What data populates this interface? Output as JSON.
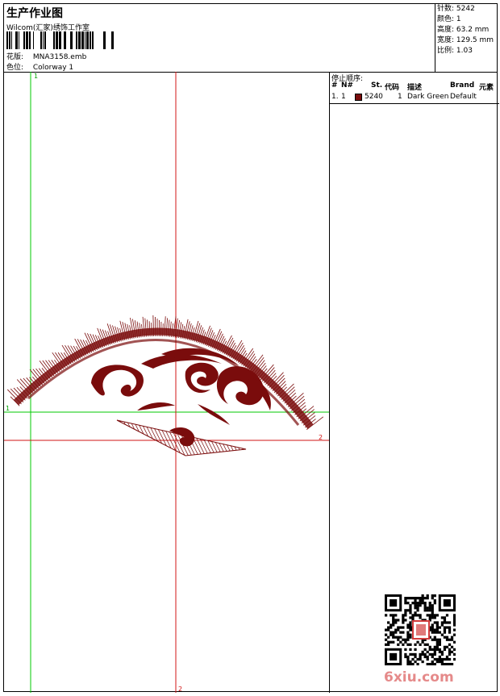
{
  "header": {
    "title": "生产作业图",
    "studio": "Wilcom(汇家)绣饰工作室",
    "pattern_label": "花版:",
    "pattern_value": "MNA3158.emb",
    "color_label": "色位:",
    "color_value": "Colorway 1"
  },
  "stats": {
    "stitches": "针数: 5242",
    "colors": "颜色: 1",
    "height": "高度: 63.2 mm",
    "width": "宽度: 129.5 mm",
    "scale": "比例: 1.03"
  },
  "stop_sequence": {
    "title": "停止顺序:",
    "headers": [
      "#",
      "N#",
      "St.",
      "代码",
      "描述",
      "Brand",
      "元素"
    ],
    "rows": [
      {
        "idx": "1.",
        "n": "1",
        "st": "5240",
        "code": "1",
        "desc": "Dark Green",
        "brand": "Default",
        "elem": "",
        "color": "#7a0c0c"
      }
    ]
  },
  "guides": {
    "marker_1": "1",
    "marker_2": "2"
  },
  "watermark": "6xiu.com",
  "colors": {
    "thread": "#7a0c0c",
    "guide_green": "#00c800",
    "guide_red": "#d21414"
  }
}
